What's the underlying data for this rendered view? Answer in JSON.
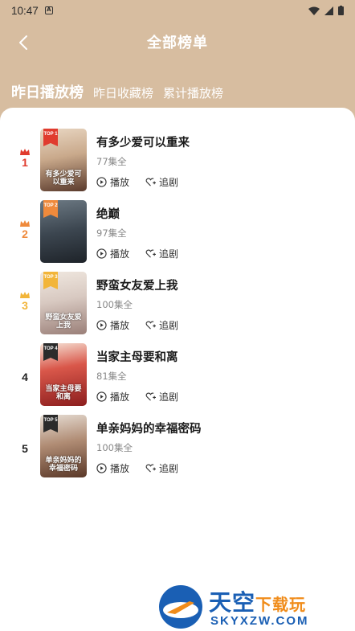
{
  "status": {
    "time": "10:47"
  },
  "header": {
    "title": "全部榜单"
  },
  "tabs": [
    {
      "label": "昨日播放榜",
      "active": true
    },
    {
      "label": "昨日收藏榜",
      "active": false
    },
    {
      "label": "累计播放榜",
      "active": false
    }
  ],
  "actions": {
    "play": "播放",
    "follow": "追剧"
  },
  "items": [
    {
      "rank": "1",
      "title": "有多少爱可以重来",
      "episodes": "77集全",
      "badge": "TOP 1",
      "cover_text": "有多少爱可以重来"
    },
    {
      "rank": "2",
      "title": "绝巅",
      "episodes": "97集全",
      "badge": "TOP 2",
      "cover_text": ""
    },
    {
      "rank": "3",
      "title": "野蛮女友爱上我",
      "episodes": "100集全",
      "badge": "TOP 3",
      "cover_text": "野蛮女友爱上我"
    },
    {
      "rank": "4",
      "title": "当家主母要和离",
      "episodes": "81集全",
      "badge": "TOP 4",
      "cover_text": "当家主母要和离"
    },
    {
      "rank": "5",
      "title": "单亲妈妈的幸福密码",
      "episodes": "100集全",
      "badge": "TOP 5",
      "cover_text": "单亲妈妈的幸福密码"
    }
  ],
  "rank_colors": [
    "#e03b2e",
    "#ef8a3c",
    "#f2b53a",
    "#222222",
    "#222222"
  ],
  "watermark": {
    "top": "天空",
    "top_accent": "下载玩",
    "bottom": "SKYXZW.COM"
  }
}
